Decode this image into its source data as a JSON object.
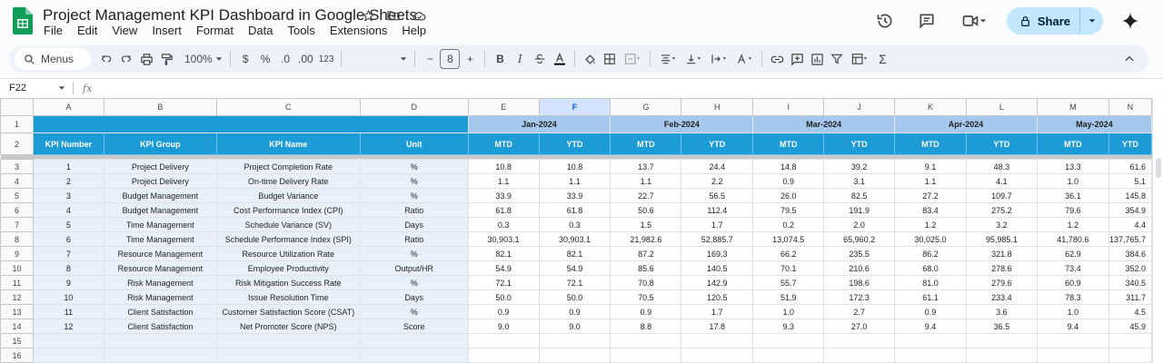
{
  "doc": {
    "title": "Project Management KPI Dashboard in Google Sheets",
    "menus": [
      "File",
      "Edit",
      "View",
      "Insert",
      "Format",
      "Data",
      "Tools",
      "Extensions",
      "Help"
    ]
  },
  "share": {
    "label": "Share"
  },
  "toolbar": {
    "menus_label": "Menus",
    "zoom": "100%",
    "currency": "$",
    "percent": "%",
    "dec_decrease": ".0",
    "dec_increase": ".00",
    "number_format": "123",
    "font_size": "8",
    "minus": "−",
    "plus": "+",
    "bold": "B",
    "italic": "I",
    "sum": "Σ"
  },
  "formula_bar": {
    "cell_ref": "F22",
    "fx": "fx"
  },
  "sheet": {
    "columns": [
      "A",
      "B",
      "C",
      "D",
      "E",
      "F",
      "G",
      "H",
      "I",
      "J",
      "K",
      "L",
      "M",
      "N"
    ],
    "months": [
      "Jan-2024",
      "Feb-2024",
      "Mar-2024",
      "Apr-2024",
      "May-2024"
    ],
    "headers": {
      "kpi_number": "KPI Number",
      "kpi_group": "KPI Group",
      "kpi_name": "KPI Name",
      "unit": "Unit",
      "mtd": "MTD",
      "ytd": "YTD"
    },
    "rows": [
      {
        "num": "1",
        "group": "Project Delivery",
        "name": "Project Completion Rate",
        "unit": "%",
        "vals": [
          "10.8",
          "10.8",
          "13.7",
          "24.4",
          "14.8",
          "39.2",
          "9.1",
          "48.3",
          "13.3",
          "61.6"
        ]
      },
      {
        "num": "2",
        "group": "Project Delivery",
        "name": "On-time Delivery Rate",
        "unit": "%",
        "vals": [
          "1.1",
          "1.1",
          "1.1",
          "2.2",
          "0.9",
          "3.1",
          "1.1",
          "4.1",
          "1.0",
          "5.1"
        ]
      },
      {
        "num": "3",
        "group": "Budget Management",
        "name": "Budget Variance",
        "unit": "%",
        "vals": [
          "33.9",
          "33.9",
          "22.7",
          "56.5",
          "26.0",
          "82.5",
          "27.2",
          "109.7",
          "36.1",
          "145.8"
        ]
      },
      {
        "num": "4",
        "group": "Budget Management",
        "name": "Cost Performance Index (CPI)",
        "unit": "Ratio",
        "vals": [
          "61.8",
          "61.8",
          "50.6",
          "112.4",
          "79.5",
          "191.9",
          "83.4",
          "275.2",
          "79.6",
          "354.9"
        ]
      },
      {
        "num": "5",
        "group": "Time Management",
        "name": "Schedule Variance (SV)",
        "unit": "Days",
        "vals": [
          "0.3",
          "0.3",
          "1.5",
          "1.7",
          "0.2",
          "2.0",
          "1.2",
          "3.2",
          "1.2",
          "4.4"
        ]
      },
      {
        "num": "6",
        "group": "Time Management",
        "name": "Schedule Performance Index (SPI)",
        "unit": "Ratio",
        "vals": [
          "30,903.1",
          "30,903.1",
          "21,982.6",
          "52,885.7",
          "13,074.5",
          "65,960.2",
          "30,025.0",
          "95,985.1",
          "41,780.6",
          "137,765.7"
        ]
      },
      {
        "num": "7",
        "group": "Resource Management",
        "name": "Resource Utilization Rate",
        "unit": "%",
        "vals": [
          "82.1",
          "82.1",
          "87.2",
          "169.3",
          "66.2",
          "235.5",
          "86.2",
          "321.8",
          "62.9",
          "384.6"
        ]
      },
      {
        "num": "8",
        "group": "Resource Management",
        "name": "Employee Productivity",
        "unit": "Output/HR",
        "vals": [
          "54.9",
          "54.9",
          "85.6",
          "140.5",
          "70.1",
          "210.6",
          "68.0",
          "278.6",
          "73.4",
          "352.0"
        ]
      },
      {
        "num": "9",
        "group": "Risk Management",
        "name": "Risk Mitigation Success Rate",
        "unit": "%",
        "vals": [
          "72.1",
          "72.1",
          "70.8",
          "142.9",
          "55.7",
          "198.6",
          "81.0",
          "279.6",
          "60.9",
          "340.5"
        ]
      },
      {
        "num": "10",
        "group": "Risk Management",
        "name": "Issue Resolution Time",
        "unit": "Days",
        "vals": [
          "50.0",
          "50.0",
          "70.5",
          "120.5",
          "51.9",
          "172.3",
          "61.1",
          "233.4",
          "78.3",
          "311.7"
        ]
      },
      {
        "num": "11",
        "group": "Client Satisfaction",
        "name": "Customer Satisfaction Score (CSAT)",
        "unit": "%",
        "vals": [
          "0.9",
          "0.9",
          "0.9",
          "1.7",
          "1.0",
          "2.7",
          "0.9",
          "3.6",
          "1.0",
          "4.5"
        ]
      },
      {
        "num": "12",
        "group": "Client Satisfaction",
        "name": "Net Promoter Score (NPS)",
        "unit": "Score",
        "vals": [
          "9.0",
          "9.0",
          "8.8",
          "17.8",
          "9.3",
          "27.0",
          "9.4",
          "36.5",
          "9.4",
          "45.9"
        ]
      }
    ],
    "empty_rows": [
      "15",
      "16"
    ]
  },
  "colors": {
    "header_blue": "#1d9bd6",
    "month_blue": "#a4c8ee",
    "share_bg": "#c2e7ff",
    "left_fill": "#e8f0fb"
  }
}
